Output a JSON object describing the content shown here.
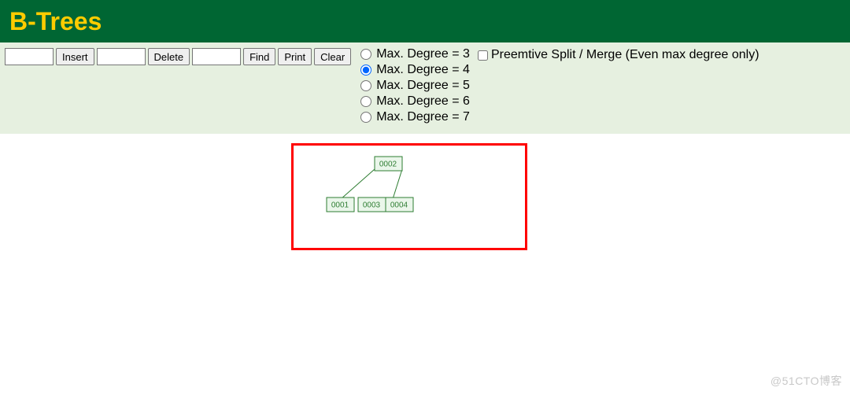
{
  "header": {
    "title": "B-Trees"
  },
  "controls": {
    "insert_value": "",
    "insert_label": "Insert",
    "delete_value": "",
    "delete_label": "Delete",
    "find_value": "",
    "find_label": "Find",
    "print_label": "Print",
    "clear_label": "Clear"
  },
  "degrees": {
    "options": [
      {
        "label": "Max. Degree = 3",
        "checked": false
      },
      {
        "label": "Max. Degree = 4",
        "checked": true
      },
      {
        "label": "Max. Degree = 5",
        "checked": false
      },
      {
        "label": "Max. Degree = 6",
        "checked": false
      },
      {
        "label": "Max. Degree = 7",
        "checked": false
      }
    ]
  },
  "preemptive": {
    "label": "Preemtive Split / Merge (Even max degree only)",
    "checked": false
  },
  "tree": {
    "root": {
      "keys": [
        "0002"
      ]
    },
    "children": [
      {
        "keys": [
          "0001"
        ]
      },
      {
        "keys": [
          "0003",
          "0004"
        ]
      }
    ]
  },
  "watermark": "@51CTO博客"
}
